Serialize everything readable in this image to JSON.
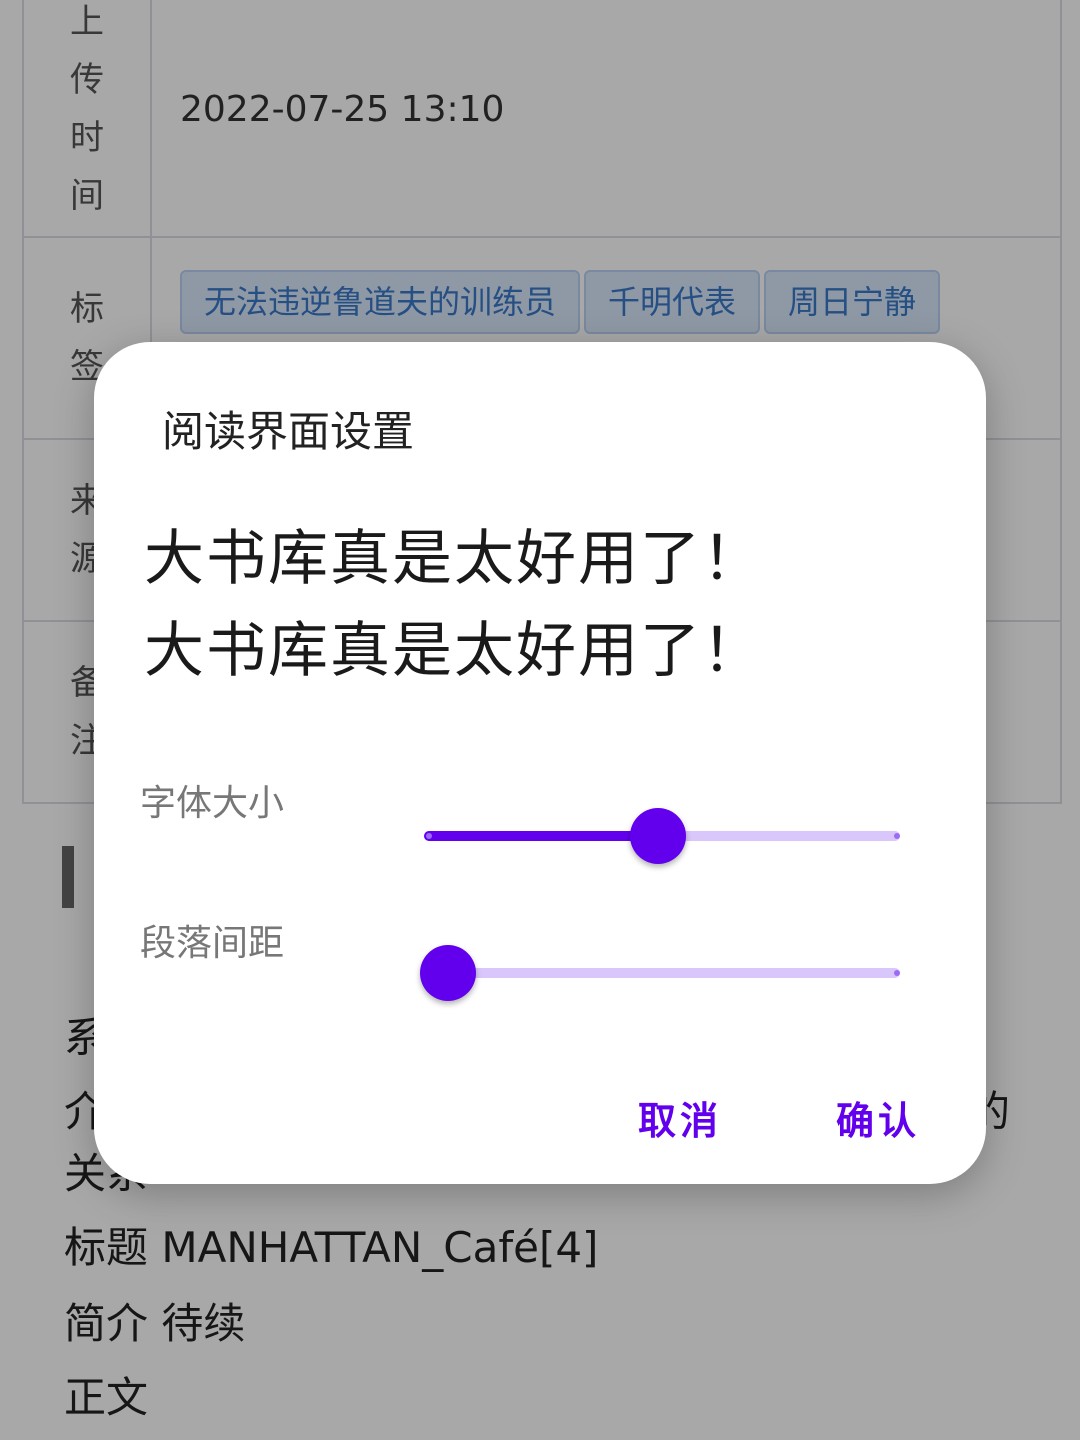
{
  "background": {
    "rows": [
      {
        "label_chars": [
          "上",
          "传",
          "时",
          "间"
        ],
        "value": "2022-07-25 13:10"
      },
      {
        "label_chars": [
          "标",
          "签"
        ],
        "tags": [
          "无法违逆鲁道夫的训练员",
          "千明代表",
          "周日宁静"
        ]
      },
      {
        "label_chars": [
          "来",
          "源"
        ]
      },
      {
        "label_chars": [
          "备",
          "注"
        ]
      }
    ],
    "lines": {
      "line1": "系",
      "line2": "介",
      "line2_end": "的",
      "line3": "关系",
      "title_line": "标题 MANHATTAN_Café[4]",
      "intro_line": "简介 待续",
      "body_line": "正文"
    }
  },
  "dialog": {
    "title": "阅读界面设置",
    "preview_text_1": "大书库真是太好用了！",
    "preview_text_2": "大书库真是太好用了！",
    "font_size_label": "字体大小",
    "font_size_value": 0.5,
    "paragraph_spacing_label": "段落间距",
    "paragraph_spacing_value": 0.0,
    "cancel_label": "取消",
    "confirm_label": "确认",
    "accent_color": "#6200ee"
  }
}
